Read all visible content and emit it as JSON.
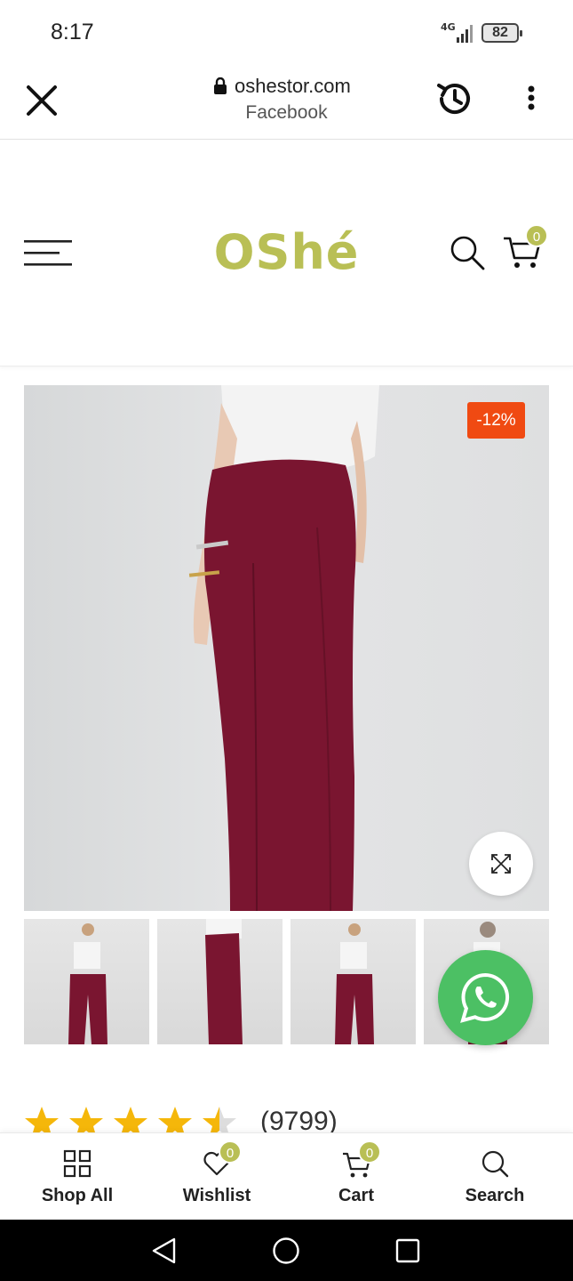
{
  "status_bar": {
    "time": "8:17",
    "network": "4G",
    "battery": "82"
  },
  "browser": {
    "domain": "oshestor.com",
    "source": "Facebook"
  },
  "header": {
    "logo_text": "OShé",
    "cart_count": "0"
  },
  "product": {
    "discount": "-12%",
    "rating_count": "(9799)",
    "rating_stars": 4.5
  },
  "bottom_nav": {
    "items": [
      {
        "label": "Shop All"
      },
      {
        "label": "Wishlist",
        "badge": "0"
      },
      {
        "label": "Cart",
        "badge": "0"
      },
      {
        "label": "Search"
      }
    ]
  },
  "colors": {
    "brand": "#b9bf55",
    "discount": "#f04a12",
    "whatsapp": "#4cc064",
    "pants": "#7a1530"
  }
}
